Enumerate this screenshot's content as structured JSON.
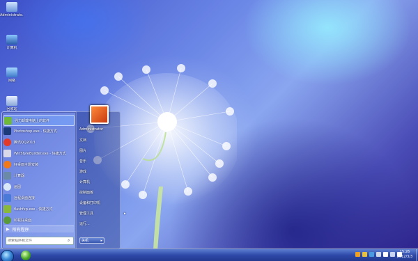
{
  "desktop_icons": [
    {
      "label": "Administrato...",
      "icon": "user-folder-icon"
    },
    {
      "label": "计算机",
      "icon": "computer-icon"
    },
    {
      "label": "网络",
      "icon": "network-icon"
    },
    {
      "label": "回收站",
      "icon": "recycle-bin-icon"
    }
  ],
  "start_menu": {
    "programs": [
      {
        "label": "强力卸载电脑上的软件",
        "icon": "uninstall-icon",
        "color": "#6fb83a"
      },
      {
        "label": "Photoshop.exe - 快捷方式",
        "icon": "photoshop-icon",
        "color": "#1a3a7a"
      },
      {
        "label": "腾讯QQ2013",
        "icon": "qq-icon",
        "color": "#e23a2a"
      },
      {
        "label": "WinStyleBuilder.exe - 快捷方式",
        "icon": "pen-icon",
        "color": "#d8d8e8"
      },
      {
        "label": "好桌面主题安装",
        "icon": "theme-icon",
        "color": "#f07a1a"
      },
      {
        "label": "计算器",
        "icon": "calculator-icon",
        "color": "#6a8aa8"
      },
      {
        "label": "画图",
        "icon": "paint-icon",
        "color": "#d8e8f8"
      },
      {
        "label": "远程桌面连接",
        "icon": "remote-desktop-icon",
        "color": "#4a7ad8"
      },
      {
        "label": "flashfxp.exe - 快捷方式",
        "icon": "flashfxp-icon",
        "color": "#8ab83a"
      },
      {
        "label": "卸载好桌面",
        "icon": "uninstall-theme-icon",
        "color": "#5a9a3a"
      }
    ],
    "all_programs": "所有程序",
    "search_placeholder": "搜索程序和文件",
    "right_items": [
      {
        "label": "Administrator"
      },
      {
        "label": "文档"
      },
      {
        "label": "图片"
      },
      {
        "label": "音乐"
      },
      {
        "label": "游戏"
      },
      {
        "label": "计算机"
      },
      {
        "label": "控制面板"
      },
      {
        "label": "设备和打印机"
      },
      {
        "label": "管理工具",
        "has_sub": true
      },
      {
        "label": "运行..."
      }
    ],
    "shutdown_label": "关机",
    "user_picture": "user-picture-icon"
  },
  "taskbar": {
    "time": "15:26",
    "date": "2012/3/3",
    "tray_colors": [
      "#f0a020",
      "#e8c040",
      "#4a9ae0",
      "#d0d8e8",
      "#ffffff",
      "#c8d4f0",
      "#ffffff"
    ]
  },
  "colors": {
    "accent": "#2d48a8",
    "highlight": "#78aaff"
  }
}
